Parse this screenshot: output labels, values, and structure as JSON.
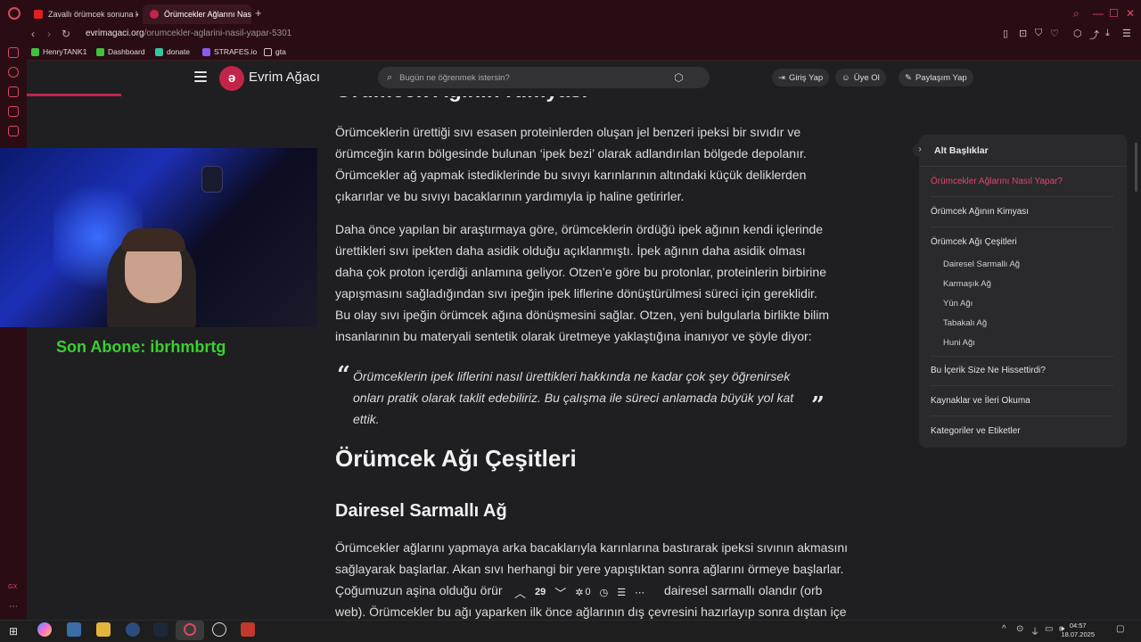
{
  "browser": {
    "tabs": [
      {
        "title": "Zavallı örümcek sonuna k",
        "active": false
      },
      {
        "title": "Örümcekler Ağlarını Nasıl",
        "active": true
      }
    ],
    "url_host": "evrimagaci.org",
    "url_path": "/orumcekler-aglarini-nasil-yapar-5301",
    "bookmarks": [
      "HenryTANK1",
      "Dashboard",
      "donate",
      "STRAFES.io",
      "gta"
    ],
    "accent": "#c2254a"
  },
  "header": {
    "brand": "Evrim Ağacı",
    "search_placeholder": "Bugün ne öğrenmek istersin?",
    "login": "Giriş Yap",
    "signup": "Üye Ol",
    "share": "Paylaşım Yap"
  },
  "overlay": {
    "subscriber": "Son Abone: ibrhmbrtg"
  },
  "article": {
    "heading_chemistry": "Örümcek Ağının Kimyası",
    "p1": "Örümceklerin ürettiği sıvı esasen proteinlerden oluşan jel benzeri ipeksi bir sıvıdır ve örümceğin karın bölgesinde bulunan ‘ipek bezi’ olarak adlandırılan bölgede depolanır. Örümcekler ağ yapmak istediklerinde bu sıvıyı karınlarının altındaki küçük deliklerden çıkarırlar ve bu sıvıyı bacaklarının yardımıyla ip haline getirirler.",
    "p2": "Daha önce yapılan bir araştırmaya göre, örümceklerin ördüğü ipek ağının kendi içlerinde ürettikleri sıvı ipekten daha asidik olduğu açıklanmıştı. İpek ağının daha asidik olması daha çok proton içerdiği anlamına geliyor. Otzen’e göre bu protonlar, proteinlerin birbirine yapışmasını sağladığından sıvı ipeğin ipek liflerine dönüştürülmesi süreci için gereklidir. Bu olay sıvı ipeğin örümcek ağına dönüşmesini sağlar. Otzen, yeni bulgularla birlikte bilim insanlarının bu materyali sentetik olarak üretmeye yaklaştığına inanıyor ve şöyle diyor:",
    "quote": "Örümceklerin ipek liflerini nasıl ürettikleri hakkında ne kadar çok şey öğrenirsek onları pratik olarak taklit edebiliriz. Bu çalışma ile süreci anlamada büyük yol kat ettik.",
    "heading_types": "Örümcek Ağı Çeşitleri",
    "heading_orb": "Dairesel Sarmallı Ağ",
    "p3_line1": "Örümcekler ağlarını yapmaya arka bacaklarıyla karınlarına bastırarak ipeksi sıvının akmasını",
    "p3_line2": "sağlayarak başlarlar. Akan sıvı herhangi bir yere yapıştıktan sonra ağlarını örmeye başlarlar.",
    "p3_line3a": "Çoğumuzun aşina olduğu örür",
    "p3_line3b": "dairesel sarmallı olandır (orb",
    "p3_line4": "web). Örümcekler bu ağı yaparken ilk önce ağlarının dış çevresini hazırlayıp sonra dıştan içe"
  },
  "toc": {
    "title": "Alt Başlıklar",
    "items": [
      {
        "label": "Örümcekler Ağlarını Nasıl Yapar?",
        "active": true,
        "sub": false
      },
      {
        "label": "Örümcek Ağının Kimyası",
        "active": false,
        "sub": false
      },
      {
        "label": "Örümcek Ağı Çeşitleri",
        "active": false,
        "sub": false
      },
      {
        "label": "Dairesel Sarmallı Ağ",
        "active": false,
        "sub": true
      },
      {
        "label": "Karmaşık Ağ",
        "active": false,
        "sub": true
      },
      {
        "label": "Yün Ağı",
        "active": false,
        "sub": true
      },
      {
        "label": "Tabakalı Ağ",
        "active": false,
        "sub": true
      },
      {
        "label": "Huni Ağı",
        "active": false,
        "sub": true
      },
      {
        "label": "Bu İçerik Size Ne Hissettirdi?",
        "active": false,
        "sub": false
      },
      {
        "label": "Kaynaklar ve İleri Okuma",
        "active": false,
        "sub": false
      },
      {
        "label": "Kategoriler ve Etiketler",
        "active": false,
        "sub": false
      }
    ]
  },
  "floatbar": {
    "votes": "29",
    "comments": "0"
  },
  "taskbar": {
    "time": "04:57",
    "date": "18.07.2025"
  }
}
